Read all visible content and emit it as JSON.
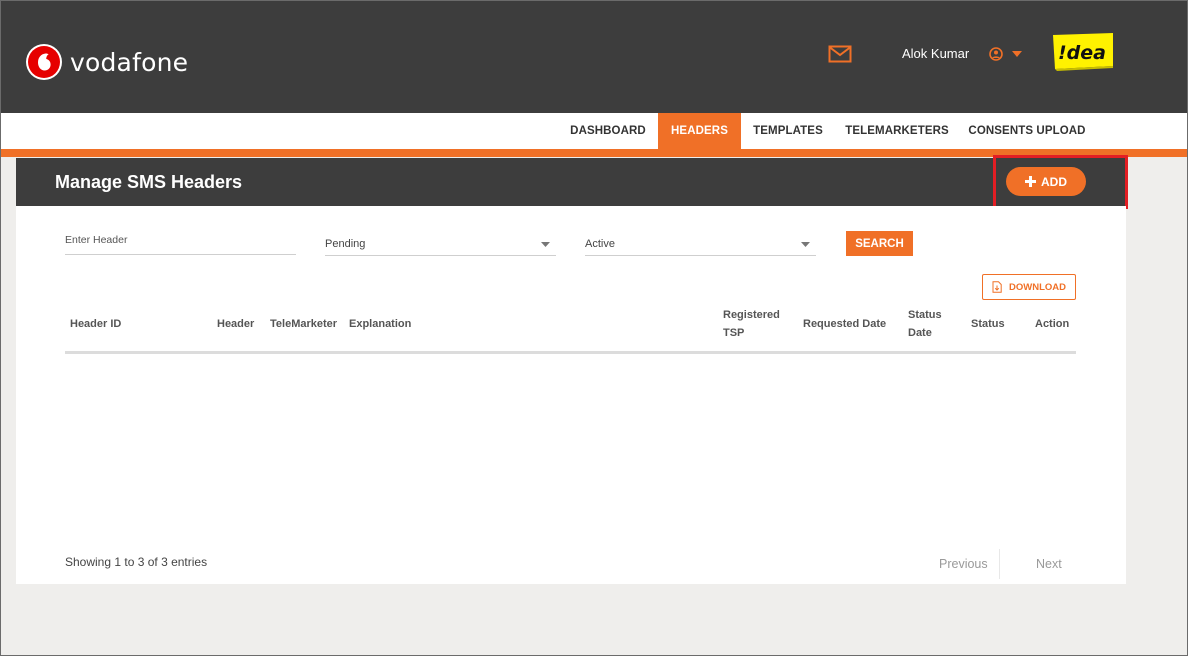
{
  "header": {
    "brand_name": "vodafone",
    "user_name": "Alok Kumar",
    "partner_logo_text": "!dea",
    "colors": {
      "accent": "#f07027",
      "dark": "#3d3d3d",
      "vodafone_red": "#e60000",
      "idea_yellow": "#fff200",
      "highlight": "#e31e24"
    }
  },
  "nav": {
    "items": [
      {
        "label": "DASHBOARD"
      },
      {
        "label": "HEADERS",
        "active": true
      },
      {
        "label": "TEMPLATES"
      },
      {
        "label": "TELEMARKETERS"
      },
      {
        "label": "CONSENTS UPLOAD"
      }
    ]
  },
  "panel": {
    "title": "Manage SMS Headers",
    "add_label": "ADD"
  },
  "filters": {
    "header_placeholder": "Enter Header",
    "status_value": "Pending",
    "activity_value": "Active",
    "search_label": "SEARCH",
    "download_label": "DOWNLOAD"
  },
  "table": {
    "columns": [
      {
        "label": "Header ID"
      },
      {
        "label": "Header"
      },
      {
        "label": "TeleMarketer"
      },
      {
        "label": "Explanation"
      },
      {
        "label": "Registered",
        "label2": "TSP"
      },
      {
        "label": "Requested Date"
      },
      {
        "label": "Status",
        "label2": "Date"
      },
      {
        "label": "Status"
      },
      {
        "label": "Action"
      }
    ]
  },
  "footer": {
    "entries_text": "Showing 1 to 3 of 3 entries",
    "previous_label": "Previous",
    "next_label": "Next"
  }
}
